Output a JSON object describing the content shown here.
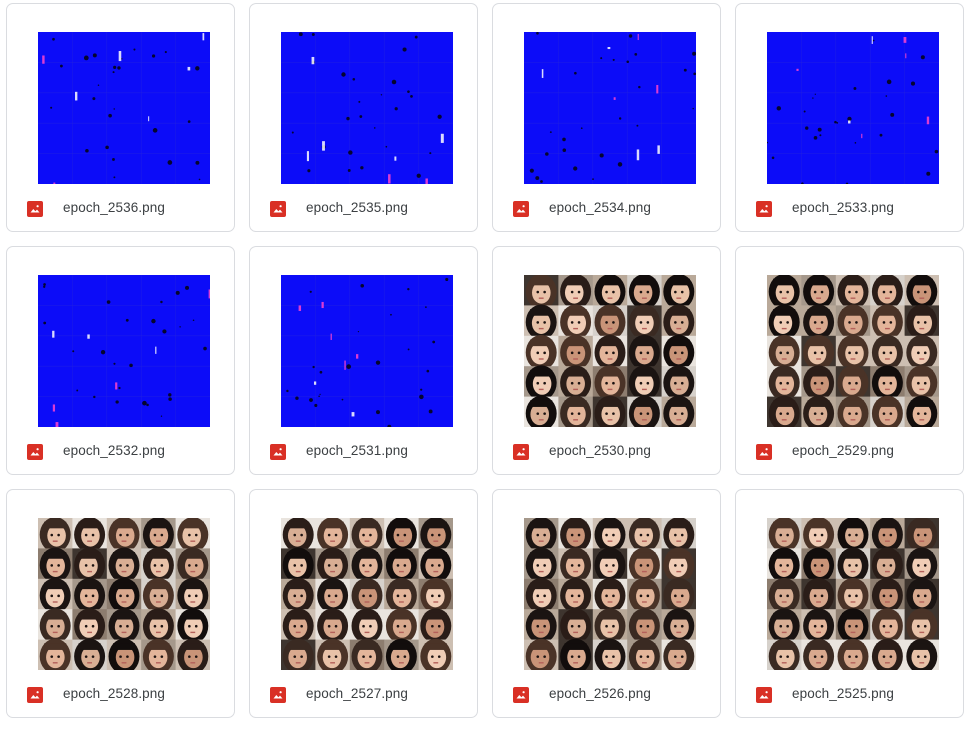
{
  "files": [
    {
      "name": "epoch_2536.png",
      "thumbnail": "blue-noise"
    },
    {
      "name": "epoch_2535.png",
      "thumbnail": "blue-noise"
    },
    {
      "name": "epoch_2534.png",
      "thumbnail": "blue-noise"
    },
    {
      "name": "epoch_2533.png",
      "thumbnail": "blue-noise"
    },
    {
      "name": "epoch_2532.png",
      "thumbnail": "blue-noise"
    },
    {
      "name": "epoch_2531.png",
      "thumbnail": "blue-noise"
    },
    {
      "name": "epoch_2530.png",
      "thumbnail": "face-grid"
    },
    {
      "name": "epoch_2529.png",
      "thumbnail": "face-grid"
    },
    {
      "name": "epoch_2528.png",
      "thumbnail": "face-grid"
    },
    {
      "name": "epoch_2527.png",
      "thumbnail": "face-grid"
    },
    {
      "name": "epoch_2526.png",
      "thumbnail": "face-grid"
    },
    {
      "name": "epoch_2525.png",
      "thumbnail": "face-grid"
    }
  ],
  "file_icon": "image-file-icon",
  "colors": {
    "image_icon": "#d93025",
    "blue_thumbnail": "#0c0cf8",
    "card_border": "#dadce0",
    "text": "#3c4043"
  }
}
